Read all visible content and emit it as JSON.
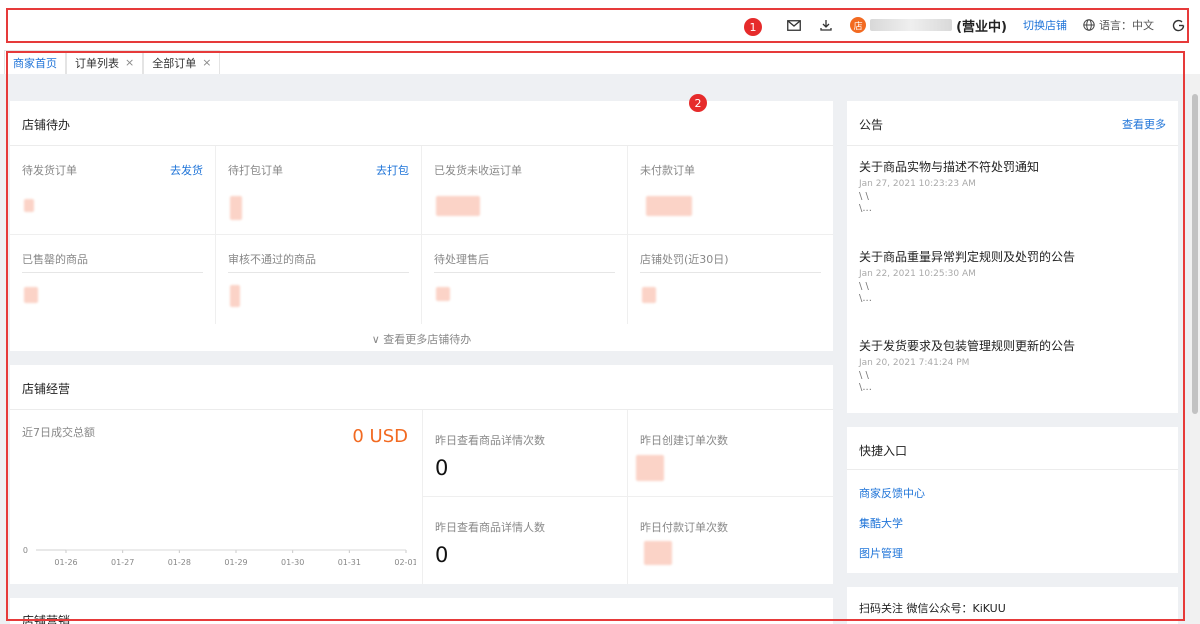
{
  "header": {
    "store_status": "营业中",
    "switch_store": "切换店铺",
    "language": "语言：中文",
    "store_avatar_char": "店"
  },
  "tabs": [
    {
      "label": "商家首页"
    },
    {
      "label": "订单列表",
      "close": "×"
    },
    {
      "label": "全部订单",
      "close": "×"
    }
  ],
  "store_todo": {
    "title": "店铺待办",
    "cells": [
      {
        "label": "待发货订单",
        "action": "去发货"
      },
      {
        "label": "待打包订单",
        "action": "去打包"
      },
      {
        "label": "已发货未收运订单"
      },
      {
        "label": "未付款订单"
      },
      {
        "label": "已售罄的商品"
      },
      {
        "label": "审核不通过的商品"
      },
      {
        "label": "待处理售后"
      },
      {
        "label": "店铺处罚(近30日)"
      }
    ],
    "more": "∨ 查看更多店铺待办"
  },
  "store_ops": {
    "title": "店铺经营",
    "sales_label": "近7日成交总额",
    "sales_value": "0 USD",
    "metrics": [
      {
        "label": "昨日查看商品详情次数",
        "value": "0"
      },
      {
        "label": "昨日创建订单次数"
      },
      {
        "label": "昨日查看商品详情人数",
        "value": "0"
      },
      {
        "label": "昨日付款订单次数"
      }
    ]
  },
  "chart_data": {
    "type": "line",
    "categories": [
      "01-26",
      "01-27",
      "01-28",
      "01-29",
      "01-30",
      "01-31",
      "02-01"
    ],
    "values": [
      0,
      0,
      0,
      0,
      0,
      0,
      0
    ],
    "y_ticks": [
      "0"
    ],
    "title": "",
    "xlabel": "",
    "ylabel": ""
  },
  "store_marketing": {
    "title": "店铺营销"
  },
  "notice": {
    "title": "公告",
    "more": "查看更多",
    "items": [
      {
        "title": "关于商品实物与描述不符处罚通知",
        "date": "Jan 27, 2021 10:23:23 AM",
        "line1": "\\ \\",
        "line2": "\\..."
      },
      {
        "title": "关于商品重量异常判定规则及处罚的公告",
        "date": "Jan 22, 2021 10:25:30 AM",
        "line1": "\\ \\",
        "line2": "\\..."
      },
      {
        "title": "关于发货要求及包装管理规则更新的公告",
        "date": "Jan 20, 2021 7:41:24 PM",
        "line1": "\\ \\",
        "line2": "\\..."
      }
    ]
  },
  "quick": {
    "title": "快捷入口",
    "links": [
      "商家反馈中心",
      "集酷大学",
      "图片管理"
    ]
  },
  "follow": {
    "text": "扫码关注 微信公众号：KiKUU"
  },
  "annotations": [
    "1",
    "2"
  ],
  "colors": {
    "accent": "#1f74d8",
    "orange": "#f26a21",
    "annotation_red": "#e63a3a"
  }
}
